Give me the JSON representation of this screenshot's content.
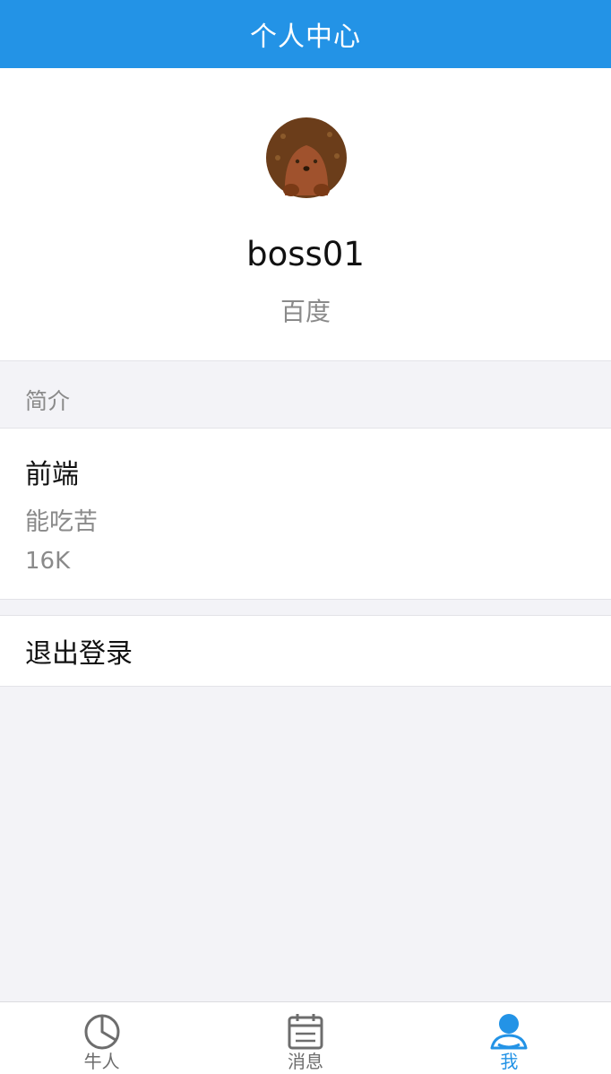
{
  "header": {
    "title": "个人中心"
  },
  "profile": {
    "avatar_icon": "hedgehog-avatar",
    "username": "boss01",
    "company": "百度"
  },
  "intro_section": {
    "title": "简介",
    "position": "前端",
    "description": "能吃苦",
    "salary": "16K"
  },
  "logout": {
    "label": "退出登录"
  },
  "tabbar": {
    "items": [
      {
        "label": "牛人",
        "icon": "pie-chart-icon",
        "active": false
      },
      {
        "label": "消息",
        "icon": "calendar-icon",
        "active": false
      },
      {
        "label": "我",
        "icon": "user-icon",
        "active": true
      }
    ]
  },
  "colors": {
    "accent": "#2393e6",
    "background": "#f3f3f7",
    "muted_text": "#8a8a8a"
  }
}
